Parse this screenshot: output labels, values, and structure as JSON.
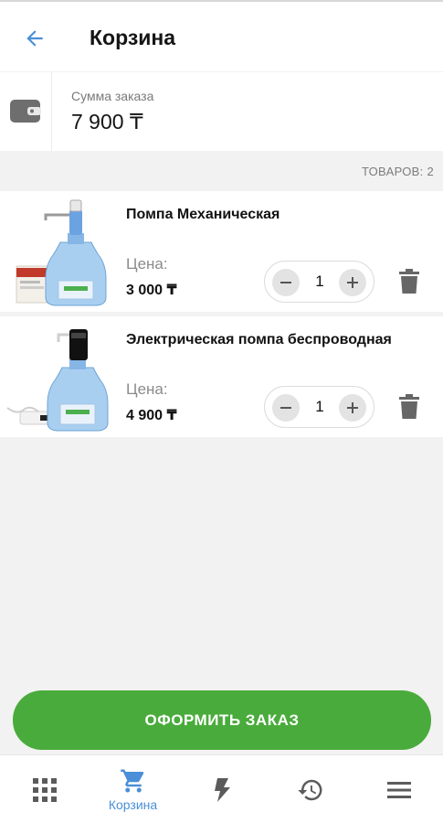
{
  "header": {
    "title": "Корзина",
    "back_icon": "arrow-back-icon"
  },
  "summary": {
    "label": "Сумма заказа",
    "value": "7 900 ₸",
    "icon": "wallet-icon"
  },
  "items_count": "ТОВАРОВ: 2",
  "products": [
    {
      "name": "Помпа Механическая",
      "price_label": "Цена:",
      "price": "3 000 ₸",
      "quantity": "1"
    },
    {
      "name": "Электрическая помпа беспроводная",
      "price_label": "Цена:",
      "price": "4 900 ₸",
      "quantity": "1"
    }
  ],
  "checkout_label": "ОФОРМИТЬ ЗАКАЗ",
  "nav": [
    {
      "id": "catalog",
      "icon": "grid-icon",
      "label": ""
    },
    {
      "id": "cart",
      "icon": "cart-icon",
      "label": "Корзина",
      "active": true
    },
    {
      "id": "promo",
      "icon": "lightning-icon",
      "label": ""
    },
    {
      "id": "history",
      "icon": "history-icon",
      "label": ""
    },
    {
      "id": "menu",
      "icon": "menu-icon",
      "label": ""
    }
  ],
  "colors": {
    "accent": "#4a8fd8",
    "checkout": "#49ab3b",
    "icon_gray": "#5b5b5b"
  }
}
